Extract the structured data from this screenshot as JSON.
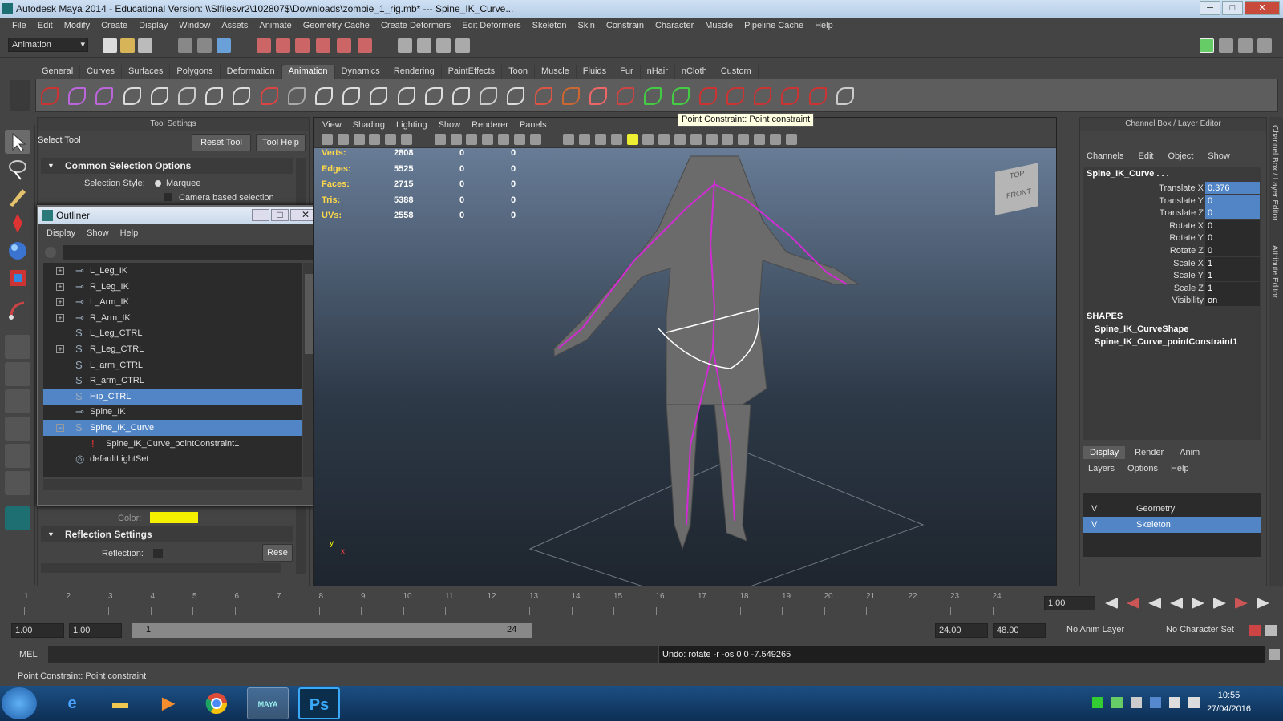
{
  "window": {
    "title": "Autodesk Maya 2014 - Educational Version: \\\\Slfilesvr2\\102807$\\Downloads\\zombie_1_rig.mb*  ---  Spine_IK_Curve...",
    "min": "─",
    "max": "□",
    "close": "✕"
  },
  "menubar": [
    "File",
    "Edit",
    "Modify",
    "Create",
    "Display",
    "Window",
    "Assets",
    "Animate",
    "Geometry Cache",
    "Create Deformers",
    "Edit Deformers",
    "Skeleton",
    "Skin",
    "Constrain",
    "Character",
    "Muscle",
    "Pipeline Cache",
    "Help"
  ],
  "status": {
    "mode": "Animation"
  },
  "shelf": {
    "tabs": [
      "General",
      "Curves",
      "Surfaces",
      "Polygons",
      "Deformation",
      "Animation",
      "Dynamics",
      "Rendering",
      "PaintEffects",
      "Toon",
      "Muscle",
      "Fluids",
      "Fur",
      "nHair",
      "nCloth",
      "Custom"
    ],
    "active": "Animation"
  },
  "tooltip": "Point Constraint: Point constraint",
  "tool_settings": {
    "header": "Tool Settings",
    "tool_name": "Select Tool",
    "reset_tool": "Reset Tool",
    "tool_help": "Tool Help",
    "section_common": "Common Selection Options",
    "selection_style_label": "Selection Style:",
    "selection_style_value": "Marquee",
    "camera_based": "Camera based selection",
    "color_label": "Color:",
    "color_value": "#f5f000",
    "section_reflection": "Reflection Settings",
    "reflection_label": "Reflection:",
    "reset_short": "Rese"
  },
  "outliner": {
    "title": "Outliner",
    "menu": [
      "Display",
      "Show",
      "Help"
    ],
    "rows": [
      {
        "label": "L_Leg_IK",
        "icon": "ik-handle-icon",
        "expand": "+"
      },
      {
        "label": "R_Leg_IK",
        "icon": "ik-handle-icon",
        "expand": "+"
      },
      {
        "label": "L_Arm_IK",
        "icon": "ik-handle-icon",
        "expand": "+"
      },
      {
        "label": "R_Arm_IK",
        "icon": "ik-handle-icon",
        "expand": "+"
      },
      {
        "label": "L_Leg_CTRL",
        "icon": "curve-icon",
        "expand": ""
      },
      {
        "label": "R_Leg_CTRL",
        "icon": "curve-icon",
        "expand": "+"
      },
      {
        "label": "L_arm_CTRL",
        "icon": "curve-icon",
        "expand": ""
      },
      {
        "label": "R_arm_CTRL",
        "icon": "curve-icon",
        "expand": ""
      },
      {
        "label": "Hip_CTRL",
        "icon": "curve-icon",
        "expand": "",
        "selected": true
      },
      {
        "label": "Spine_IK",
        "icon": "ik-handle-icon",
        "expand": ""
      },
      {
        "label": "Spine_IK_Curve",
        "icon": "curve-icon",
        "expand": "−",
        "selected": true
      },
      {
        "label": "Spine_IK_Curve_pointConstraint1",
        "icon": "constraint-icon",
        "expand": "",
        "indent": true
      },
      {
        "label": "defaultLightSet",
        "icon": "set-icon",
        "expand": ""
      }
    ]
  },
  "viewport": {
    "menu": [
      "View",
      "Shading",
      "Lighting",
      "Show",
      "Renderer",
      "Panels"
    ],
    "hud": [
      {
        "label": "Verts:",
        "v1": "2808",
        "v2": "0",
        "v3": "0"
      },
      {
        "label": "Edges:",
        "v1": "5525",
        "v2": "0",
        "v3": "0"
      },
      {
        "label": "Faces:",
        "v1": "2715",
        "v2": "0",
        "v3": "0"
      },
      {
        "label": "Tris:",
        "v1": "5388",
        "v2": "0",
        "v3": "0"
      },
      {
        "label": "UVs:",
        "v1": "2558",
        "v2": "0",
        "v3": "0"
      }
    ],
    "viewcube_top": "TOP",
    "viewcube_front": "FRONT",
    "axis_y": "y",
    "axis_x": "x"
  },
  "channel_box": {
    "header": "Channel Box / Layer Editor",
    "menu": [
      "Channels",
      "Edit",
      "Object",
      "Show"
    ],
    "object": "Spine_IK_Curve . . .",
    "channels": [
      {
        "name": "Translate X",
        "value": "0.376",
        "hl": true
      },
      {
        "name": "Translate Y",
        "value": "0",
        "hl": true
      },
      {
        "name": "Translate Z",
        "value": "0",
        "hl": true
      },
      {
        "name": "Rotate X",
        "value": "0"
      },
      {
        "name": "Rotate Y",
        "value": "0"
      },
      {
        "name": "Rotate Z",
        "value": "0"
      },
      {
        "name": "Scale X",
        "value": "1"
      },
      {
        "name": "Scale Y",
        "value": "1"
      },
      {
        "name": "Scale Z",
        "value": "1"
      },
      {
        "name": "Visibility",
        "value": "on"
      }
    ],
    "shapes_label": "SHAPES",
    "shapes": [
      "Spine_IK_CurveShape",
      "Spine_IK_Curve_pointConstraint1"
    ],
    "layer_tabs": [
      "Display",
      "Render",
      "Anim"
    ],
    "layer_menu": [
      "Layers",
      "Options",
      "Help"
    ],
    "layers": [
      {
        "name": "Geometry",
        "v": "V"
      },
      {
        "name": "Skeleton",
        "v": "V",
        "selected": true
      }
    ],
    "side_tab_1": "Channel Box / Layer Editor",
    "side_tab_2": "Attribute Editor"
  },
  "timeline": {
    "ticks": [
      "1",
      "2",
      "3",
      "4",
      "5",
      "6",
      "7",
      "8",
      "9",
      "10",
      "11",
      "12",
      "13",
      "14",
      "15",
      "16",
      "17",
      "18",
      "19",
      "20",
      "21",
      "22",
      "23",
      "24"
    ],
    "current_frame": "1.00"
  },
  "range": {
    "start": "1.00",
    "anim_start": "1.00",
    "slider_start": "1",
    "slider_end": "24",
    "end": "24.00",
    "anim_end": "48.00",
    "anim_layer": "No Anim Layer",
    "char_set": "No Character Set"
  },
  "mel": {
    "label": "MEL",
    "result": "Undo: rotate -r -os 0 0 -7.549265"
  },
  "helpline": "Point Constraint: Point constraint",
  "taskbar": {
    "time": "10:55",
    "date": "27/04/2016",
    "ps": "Ps",
    "maya": "MAYA"
  }
}
